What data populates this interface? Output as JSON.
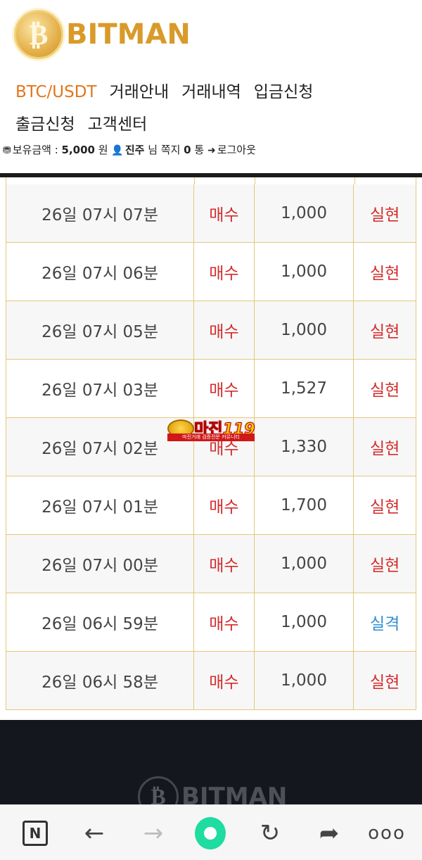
{
  "header": {
    "logo_letter": "₿",
    "logo_text": "BITMAN",
    "nav": [
      {
        "label": "BTC/USDT",
        "active": true
      },
      {
        "label": "거래안내"
      },
      {
        "label": "거래내역"
      },
      {
        "label": "입금신청"
      },
      {
        "label": "출금신청"
      },
      {
        "label": "고객센터"
      }
    ],
    "userbar": {
      "balance_label": "보유금액 :",
      "balance_value": "5,000",
      "balance_unit": "원",
      "username": "진주",
      "suffix_nim": "님 쪽지",
      "message_count": "0",
      "message_unit": "통",
      "logout": "로그아웃"
    }
  },
  "rows": [
    {
      "time": "26일 07시 07분",
      "type": "매수",
      "amount": "1,000",
      "result": "실현"
    },
    {
      "time": "26일 07시 06분",
      "type": "매수",
      "amount": "1,000",
      "result": "실현"
    },
    {
      "time": "26일 07시 05분",
      "type": "매수",
      "amount": "1,000",
      "result": "실현"
    },
    {
      "time": "26일 07시 03분",
      "type": "매수",
      "amount": "1,527",
      "result": "실현"
    },
    {
      "time": "26일 07시 02분",
      "type": "매수",
      "amount": "1,330",
      "result": "실현"
    },
    {
      "time": "26일 07시 01분",
      "type": "매수",
      "amount": "1,700",
      "result": "실현"
    },
    {
      "time": "26일 07시 00분",
      "type": "매수",
      "amount": "1,000",
      "result": "실현"
    },
    {
      "time": "26일 06시 59분",
      "type": "매수",
      "amount": "1,000",
      "result": "실격"
    },
    {
      "time": "26일 06시 58분",
      "type": "매수",
      "amount": "1,000",
      "result": "실현"
    }
  ],
  "watermark": {
    "text_main": "마진",
    "text_num": "119",
    "subtitle": "마진거래 검증전문 커뮤니티"
  },
  "footer": {
    "logo_letter": "₿",
    "logo_text": "BITMAN"
  },
  "browser": {
    "n_label": "N",
    "back": "←",
    "forward": "→",
    "reload": "↻",
    "share": "➦",
    "more": "ooo"
  },
  "colors": {
    "accent": "#e2761c",
    "buy_red": "#d42d2d",
    "fail_blue": "#2f8fd6",
    "border_gold": "#e3c77a",
    "footer_bg": "#15171e",
    "green": "#1fdca0"
  }
}
